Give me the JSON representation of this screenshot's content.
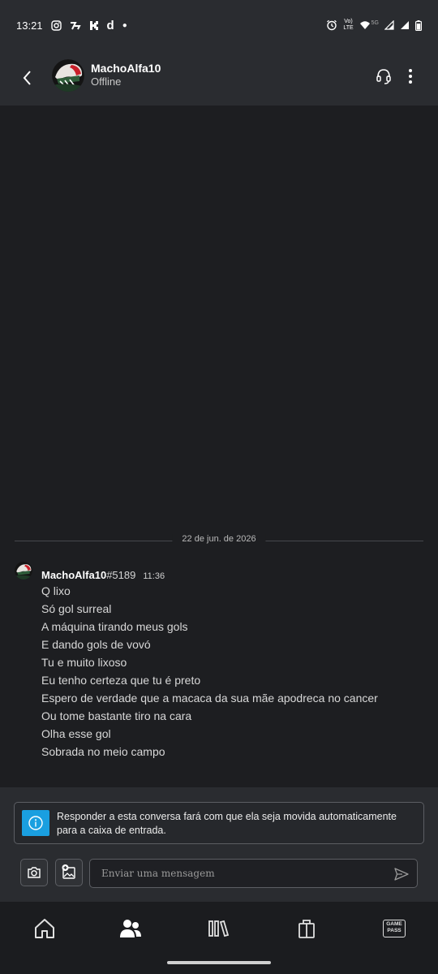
{
  "status_bar": {
    "time": "13:21",
    "left_icons": [
      "instagram-icon",
      "app-icon",
      "kick-icon",
      "d-app-icon",
      "dot-icon"
    ],
    "right_icons": [
      "alarm-icon",
      "volte-icon",
      "5g-signal-icon",
      "wifi-icon",
      "signal-icon",
      "signal-icon",
      "battery-icon"
    ],
    "volte_label_top": "Vo)",
    "volte_label_bottom": "LTE",
    "network_label": "5G"
  },
  "header": {
    "username": "MachoAlfa10",
    "status": "Offline",
    "icons": [
      "back-arrow-icon",
      "headset-icon",
      "more-vertical-icon"
    ]
  },
  "conversation": {
    "date_divider": "22 de jun. de 2026",
    "message": {
      "author": "MachoAlfa10",
      "tag": "#5189",
      "time": "11:36",
      "lines": [
        "Q lixo",
        "Só gol surreal",
        "A máquina tirando meus gols",
        "E dando gols de vovó",
        "Tu e muito lixoso",
        "Eu tenho certeza que tu é preto",
        "Espero de verdade que a macaca da sua mãe apodreca no cancer",
        "Ou tome bastante tiro na cara",
        "Olha esse gol",
        "Sobrada no meio campo"
      ]
    }
  },
  "notice": {
    "icon": "info-icon",
    "text": "Responder a esta conversa fará com que ela seja movida automaticamente para a caixa de entrada.",
    "accent_color": "#1a9fe0"
  },
  "composer": {
    "placeholder": "Enviar uma mensagem",
    "buttons": [
      "camera-icon",
      "gallery-add-icon",
      "send-icon"
    ]
  },
  "bottom_nav": {
    "items": [
      "home-icon",
      "friends-icon",
      "library-icon",
      "store-icon",
      "game-pass-icon"
    ],
    "game_pass_label_top": "GAME",
    "game_pass_label_bottom": "PASS"
  }
}
